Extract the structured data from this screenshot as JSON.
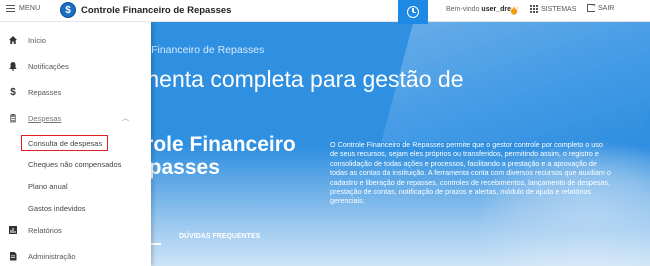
{
  "topbar": {
    "menu_label": "MENU",
    "logo_glyph": "$",
    "brand_title": "Controle Financeiro de Repasses",
    "welcome_prefix": "Bem-vindo",
    "username": "user_dre",
    "systems_label": "SISTEMAS",
    "exit_label": "SAIR",
    "accent": "#1e88e5",
    "alarm_color": "#f39c12"
  },
  "sidebar": {
    "items": [
      {
        "label": "Início",
        "icon": "home-icon"
      },
      {
        "label": "Notificações",
        "icon": "bell-icon"
      },
      {
        "label": "Repasses",
        "icon": "dollar-icon"
      },
      {
        "label": "Despesas",
        "icon": "clipboard-icon"
      },
      {
        "label": "Relatórios",
        "icon": "bar-chart-icon"
      },
      {
        "label": "Administração",
        "icon": "document-icon"
      }
    ],
    "sub_items": [
      {
        "label": "Consulta de despesas"
      },
      {
        "label": "Cheques não compensados"
      },
      {
        "label": "Plano anual"
      },
      {
        "label": "Gastos indevidos"
      }
    ],
    "highlight_color": "#e02020"
  },
  "hero": {
    "subtitle": "le Financeiro de Repasses",
    "headline": "menta completa para gestão de",
    "product_line1": "rrole Financeiro",
    "product_line2": "epasses",
    "description": "O Controle Financeiro de Repasses permite que o gestor controle por completo o uso de seus recursos, sejam eles próprios ou transferidos, permitindo assim, o registro e consolidação de todas ações e processos, facilitando a prestação e a aprovação de todas as contas da instituição. A ferramenta conta com diversos recursos que auxiliam o cadastro e liberação de repasses, controles de recebimentos, lançamento de despesas, prestação de contas, notificação de prazos e alertas, módulo de ajuda e relatórios gerenciais.",
    "tabs": [
      {
        "label": "DÚVIDAS FREQUENTES"
      }
    ],
    "background": "#2f8fe0"
  }
}
